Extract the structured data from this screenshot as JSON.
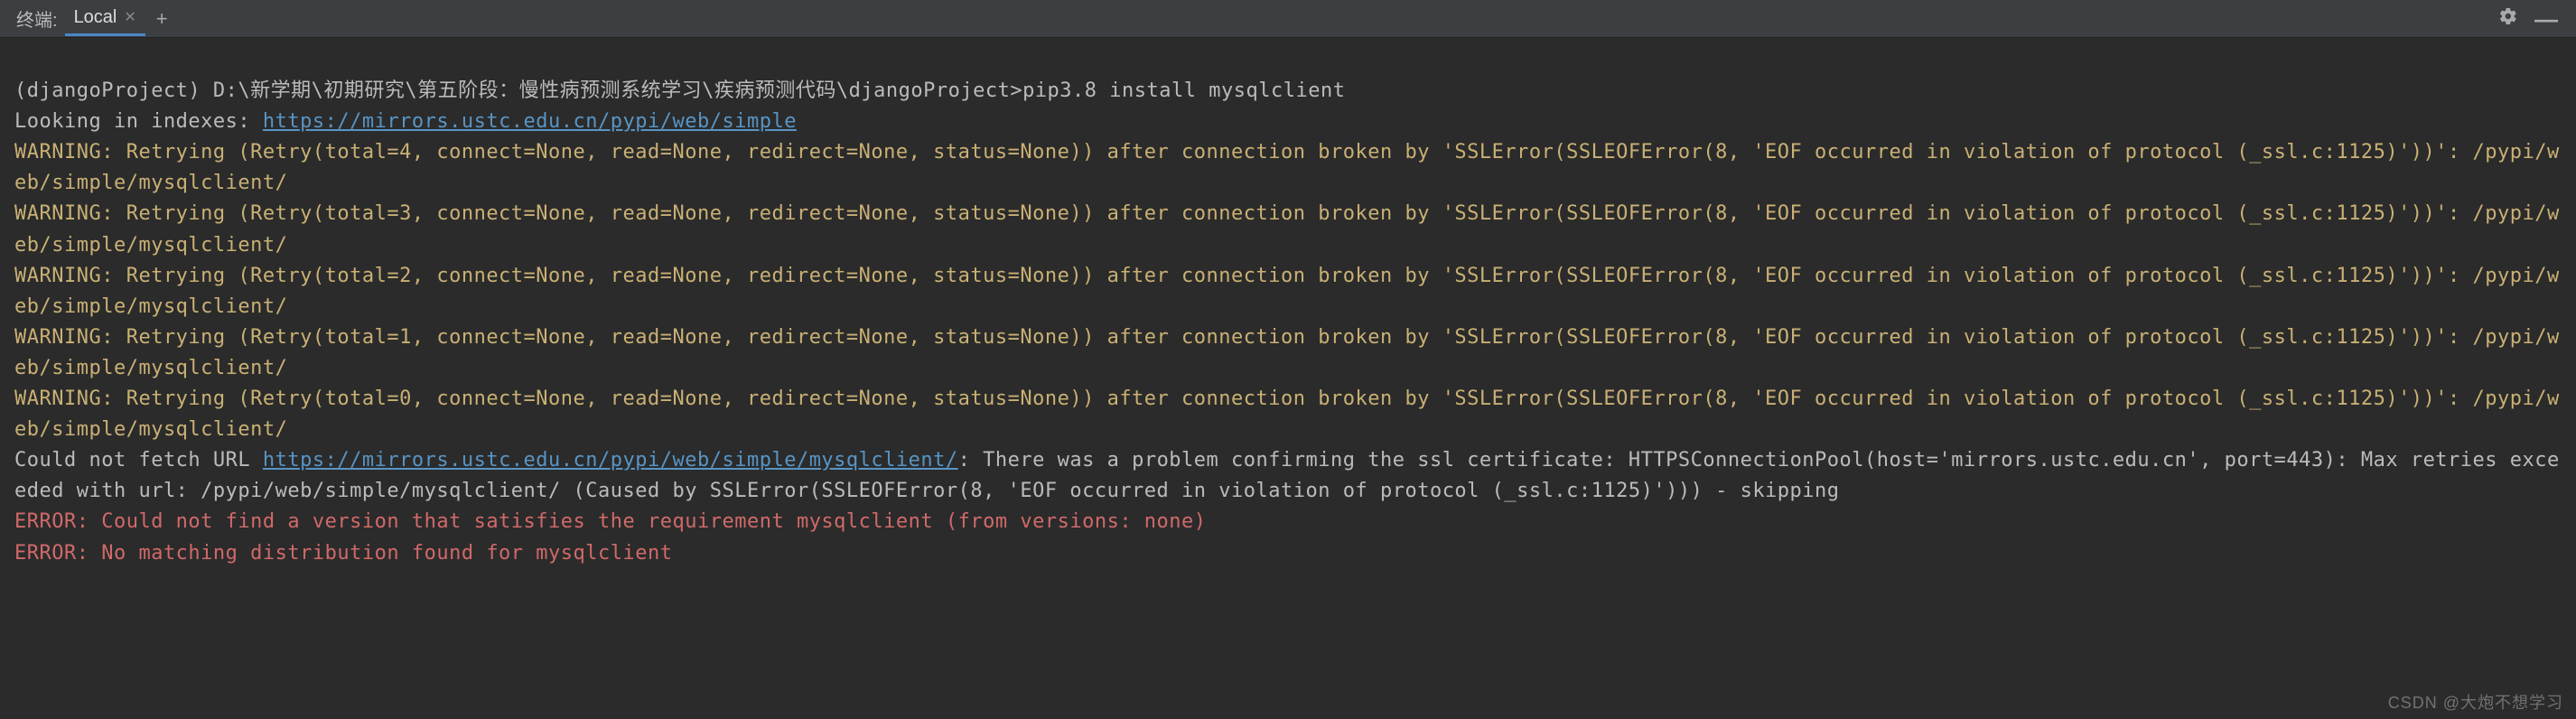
{
  "tabbar": {
    "title": "终端:",
    "tab_label": "Local",
    "add_label": "+"
  },
  "command": {
    "prompt": "(djangoProject) D:\\新学期\\初期研究\\第五阶段：慢性病预测系统学习\\疾病预测代码\\djangoProject>pip3.8 install mysqlclient"
  },
  "index_line": {
    "prefix": "Looking in indexes: ",
    "url": "https://mirrors.ustc.edu.cn/pypi/web/simple"
  },
  "warnings": [
    "WARNING: Retrying (Retry(total=4, connect=None, read=None, redirect=None, status=None)) after connection broken by 'SSLError(SSLEOFError(8, 'EOF occurred in violation of protocol (_ssl.c:1125)'))': /pypi/web/simple/mysqlclient/",
    "WARNING: Retrying (Retry(total=3, connect=None, read=None, redirect=None, status=None)) after connection broken by 'SSLError(SSLEOFError(8, 'EOF occurred in violation of protocol (_ssl.c:1125)'))': /pypi/web/simple/mysqlclient/",
    "WARNING: Retrying (Retry(total=2, connect=None, read=None, redirect=None, status=None)) after connection broken by 'SSLError(SSLEOFError(8, 'EOF occurred in violation of protocol (_ssl.c:1125)'))': /pypi/web/simple/mysqlclient/",
    "WARNING: Retrying (Retry(total=1, connect=None, read=None, redirect=None, status=None)) after connection broken by 'SSLError(SSLEOFError(8, 'EOF occurred in violation of protocol (_ssl.c:1125)'))': /pypi/web/simple/mysqlclient/",
    "WARNING: Retrying (Retry(total=0, connect=None, read=None, redirect=None, status=None)) after connection broken by 'SSLError(SSLEOFError(8, 'EOF occurred in violation of protocol (_ssl.c:1125)'))': /pypi/web/simple/mysqlclient/"
  ],
  "fetch_fail": {
    "prefix": "Could not fetch URL ",
    "url": "https://mirrors.ustc.edu.cn/pypi/web/simple/mysqlclient/",
    "suffix": ": There was a problem confirming the ssl certificate: HTTPSConnectionPool(host='mirrors.ustc.edu.cn', port=443): Max retries exceeded with url: /pypi/web/simple/mysqlclient/ (Caused by SSLError(SSLEOFError(8, 'EOF occurred in violation of protocol (_ssl.c:1125)'))) - skipping"
  },
  "errors": [
    "ERROR: Could not find a version that satisfies the requirement mysqlclient (from versions: none)",
    "ERROR: No matching distribution found for mysqlclient"
  ],
  "watermark": "CSDN @大炮不想学习"
}
